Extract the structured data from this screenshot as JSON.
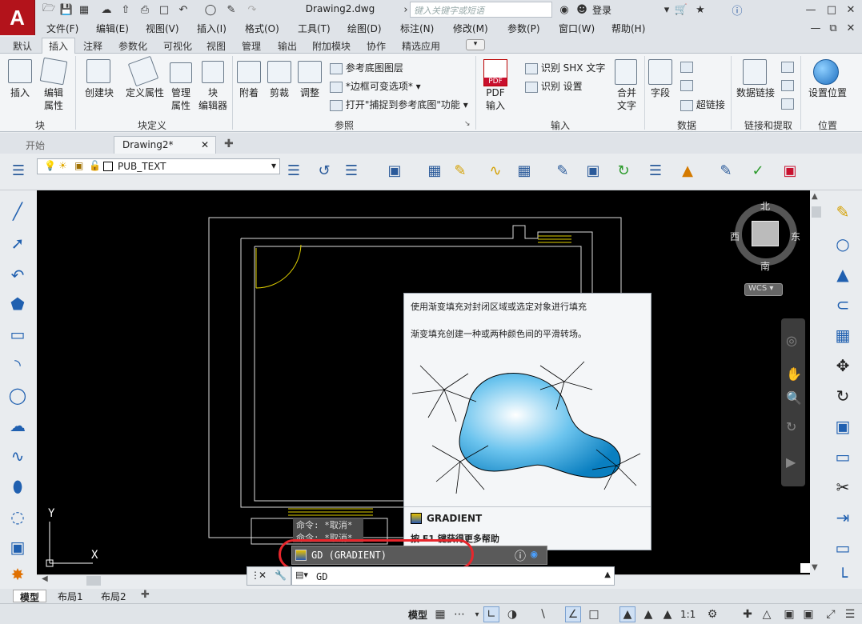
{
  "app": {
    "logo_letter": "A",
    "document_title": "Drawing2.dwg",
    "search_placeholder": "键入关键字或短语",
    "login_label": "登录",
    "brand_color": "#b3131b"
  },
  "menubar": [
    "文件(F)",
    "编辑(E)",
    "视图(V)",
    "插入(I)",
    "格式(O)",
    "工具(T)",
    "绘图(D)",
    "标注(N)",
    "修改(M)",
    "参数(P)",
    "窗口(W)",
    "帮助(H)"
  ],
  "ribbon_tabs": [
    "默认",
    "插入",
    "注释",
    "参数化",
    "可视化",
    "视图",
    "管理",
    "输出",
    "附加模块",
    "协作",
    "精选应用"
  ],
  "active_ribbon_tab": "插入",
  "ribbon": {
    "block_panel": {
      "title": "块",
      "insert": "插入",
      "edit_attr_1": "编辑",
      "edit_attr_2": "属性"
    },
    "block_def_panel": {
      "title": "块定义",
      "create": "创建块",
      "define_attr": "定义属性",
      "manage_1": "管理",
      "manage_2": "属性",
      "block_1": "块",
      "block_2": "编辑器"
    },
    "reference_panel": {
      "title": "参照",
      "attach": "附着",
      "clip": "剪裁",
      "adjust": "调整",
      "underlay_layers": "参考底图图层",
      "frame_option": "*边框可变选项*",
      "snap_option": "打开\"捕捉到参考底图\"功能"
    },
    "import_panel": {
      "title": "输入",
      "pdf": "PDF",
      "pdf_import": "PDF",
      "pdf_import_2": "输入",
      "shx": "识别 SHX 文字",
      "recog_settings": "识别 设置",
      "combine_1": "合并",
      "combine_2": "文字"
    },
    "data_panel": {
      "title": "数据",
      "field": "字段",
      "hyperlink": "超链接"
    },
    "link_panel": {
      "title": "链接和提取",
      "data_link": "数据链接"
    },
    "location_panel": {
      "title": "位置",
      "set_location": "设置位置"
    }
  },
  "doc_tabs": [
    "开始",
    "Drawing2*"
  ],
  "layer": {
    "name": "PUB_TEXT"
  },
  "compass": {
    "north": "北",
    "south": "南",
    "east": "东",
    "west": "西",
    "wcs": "WCS"
  },
  "tooltip": {
    "line1": "使用渐变填充对封闭区域或选定对象进行填充",
    "line2": "渐变填充创建一种或两种颜色间的平滑转场。",
    "command": "GRADIENT",
    "help": "按 F1 键获得更多帮助"
  },
  "command_history": [
    "命令: *取消*",
    "命令: *取消*"
  ],
  "command_suggestion": "GD (GRADIENT)",
  "command_input": "GD",
  "layout_tabs": [
    "模型",
    "布局1",
    "布局2"
  ],
  "status": {
    "model": "模型",
    "scale": "1:1"
  },
  "ucs": {
    "x": "X",
    "y": "Y"
  }
}
